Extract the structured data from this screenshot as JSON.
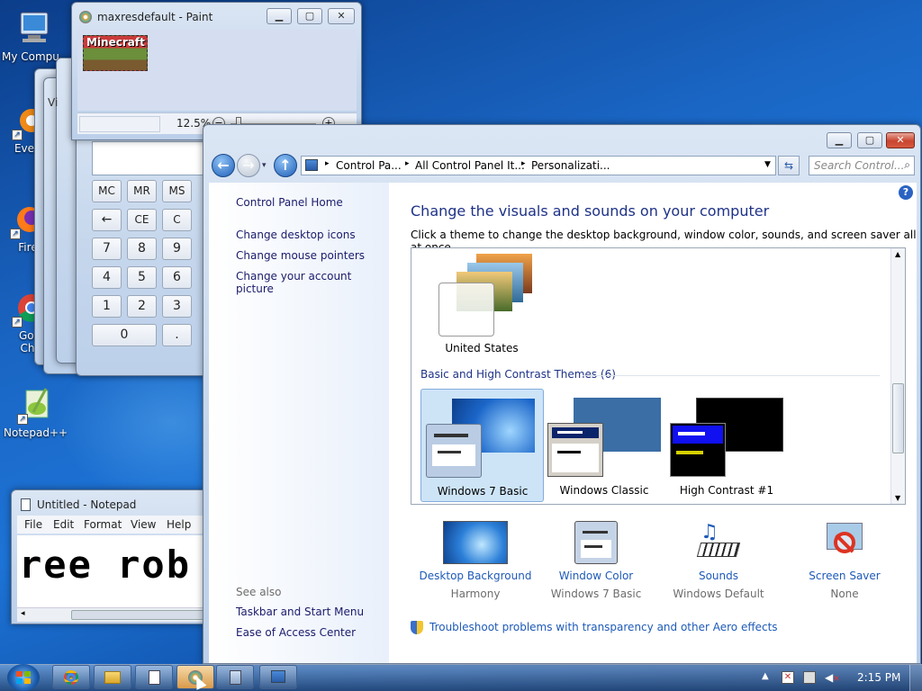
{
  "desktop": {
    "icons": [
      {
        "label": "My Compu",
        "name": "my-computer"
      },
      {
        "label": "Every",
        "name": "everything"
      },
      {
        "label": "Fire",
        "name": "firefox"
      },
      {
        "label": "Goo",
        "label2": "Chr",
        "name": "google-chrome"
      },
      {
        "label": "Notepad++",
        "name": "notepad-plus-plus"
      }
    ]
  },
  "paint": {
    "title": "maxresdefault - Paint",
    "zoom": "12.5%",
    "image_text": "Minecraft"
  },
  "calculator": {
    "memory": [
      "MC",
      "MR",
      "MS"
    ],
    "row2": [
      "←",
      "CE",
      "C"
    ],
    "row3": [
      "7",
      "8",
      "9"
    ],
    "row4": [
      "4",
      "5",
      "6"
    ],
    "row5": [
      "1",
      "2",
      "3"
    ],
    "row6": [
      "0",
      "."
    ],
    "menu_letter": "Vi"
  },
  "notepad": {
    "title": "Untitled - Notepad",
    "menu": [
      "File",
      "Edit",
      "Format",
      "View",
      "Help"
    ],
    "content": "ree rob"
  },
  "personalization": {
    "breadcrumb": [
      "Control Pa...",
      "All Control Panel It...",
      "Personalizati..."
    ],
    "search_placeholder": "Search Control...",
    "sidebar": {
      "home": "Control Panel Home",
      "links": [
        "Change desktop icons",
        "Change mouse pointers",
        "Change your account picture"
      ],
      "see_also_title": "See also",
      "see_also": [
        "Taskbar and Start Menu",
        "Ease of Access Center"
      ]
    },
    "heading": "Change the visuals and sounds on your computer",
    "subheading": "Click a theme to change the desktop background, window color, sounds, and screen saver all at once.",
    "installed_theme": "United States",
    "basic_section": "Basic and High Contrast Themes (6)",
    "basic_themes": [
      "Windows 7 Basic",
      "Windows Classic",
      "High Contrast #1"
    ],
    "selected_theme": "Windows 7 Basic",
    "bottom": [
      {
        "title": "Desktop Background",
        "value": "Harmony"
      },
      {
        "title": "Window Color",
        "value": "Windows 7 Basic"
      },
      {
        "title": "Sounds",
        "value": "Windows Default"
      },
      {
        "title": "Screen Saver",
        "value": "None"
      }
    ],
    "troubleshoot": "Troubleshoot problems with transparency and other Aero effects"
  },
  "taskbar": {
    "clock": "2:15 PM"
  },
  "colors": {
    "link": "#1e3f9e",
    "heading": "#1e3287",
    "selected_tile": "#cde4f7"
  }
}
